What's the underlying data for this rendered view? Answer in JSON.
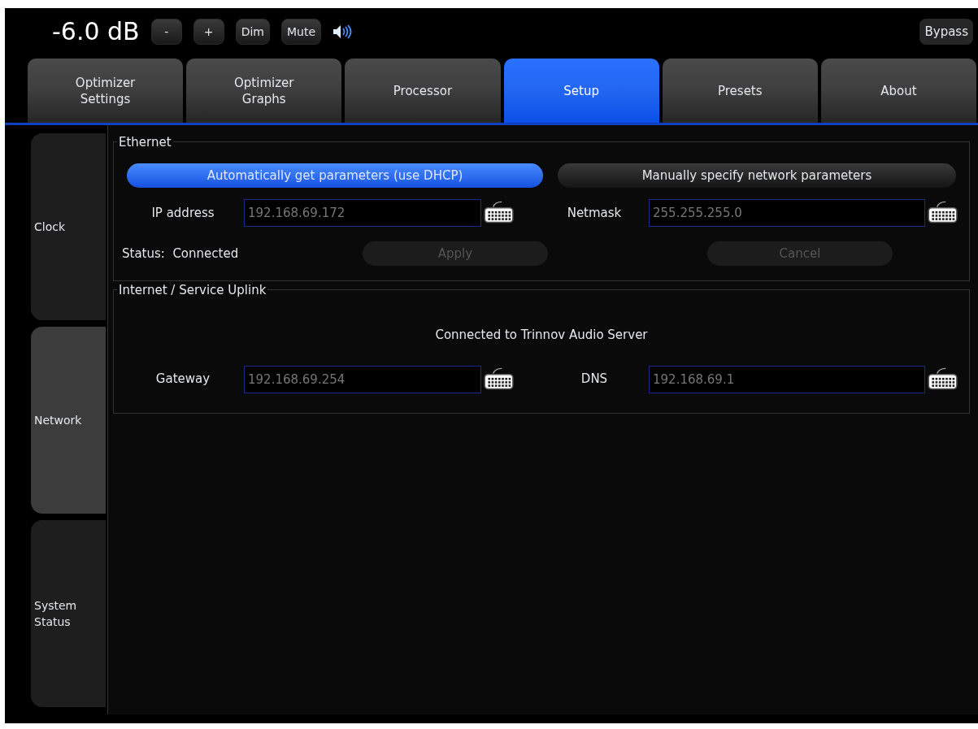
{
  "top_bar": {
    "volume": "-6.0 dB",
    "buttons": [
      "-",
      "+",
      "Dim",
      "Mute"
    ],
    "bypass": "Bypass"
  },
  "tabs": [
    {
      "label": "Optimizer Settings",
      "selected": false
    },
    {
      "label": "Optimizer Graphs",
      "selected": false
    },
    {
      "label": "Processor",
      "selected": false
    },
    {
      "label": "Setup",
      "selected": true
    },
    {
      "label": "Presets",
      "selected": false
    },
    {
      "label": "About",
      "selected": false
    }
  ],
  "side_tabs": [
    {
      "label": "Clock",
      "selected": false
    },
    {
      "label": "Network",
      "selected": true
    },
    {
      "label": "System Status",
      "selected": false
    }
  ],
  "ethernet": {
    "title": "Ethernet",
    "modes": [
      {
        "label": "Automatically get parameters (use DHCP)",
        "selected": true
      },
      {
        "label": "Manually specify network parameters",
        "selected": false
      }
    ],
    "fields": [
      {
        "label": "IP address",
        "value": "192.168.69.172"
      },
      {
        "label": "Netmask",
        "value": "255.255.255.0"
      }
    ],
    "status": "Status:  Connected",
    "actions": [
      {
        "label": "Apply",
        "disabled": true
      },
      {
        "label": "Cancel",
        "disabled": true
      }
    ]
  },
  "uplink": {
    "title": "Internet / Service Uplink",
    "message": "Connected to Trinnov Audio Server",
    "fields": [
      {
        "label": "Gateway",
        "value": "192.168.69.254"
      },
      {
        "label": "DNS",
        "value": "192.168.69.1"
      }
    ]
  }
}
